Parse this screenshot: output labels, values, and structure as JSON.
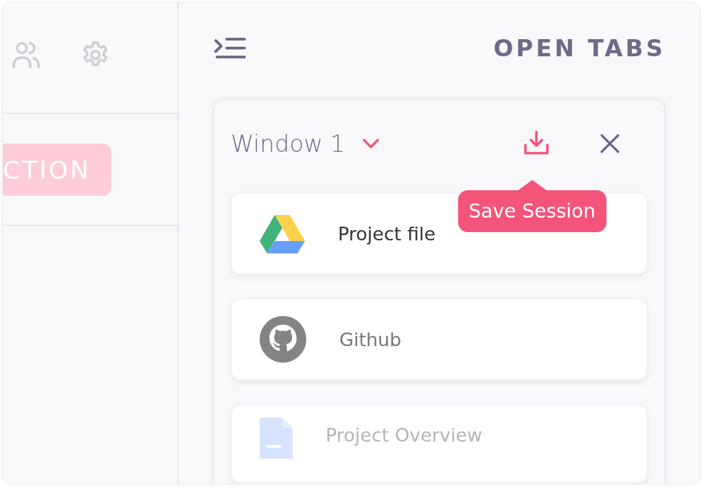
{
  "sidebar": {
    "icons": [
      {
        "kind": "users"
      },
      {
        "kind": "settings"
      }
    ],
    "action_button": "CTION"
  },
  "panel": {
    "title": "OPEN TABS",
    "window": {
      "title": "Window 1",
      "expanded": true,
      "tooltip": "Save Session",
      "tabs": [
        {
          "kind": "drive",
          "title": "Project file"
        },
        {
          "kind": "github",
          "title": "Github"
        },
        {
          "kind": "doc",
          "title": "Project Overview"
        }
      ]
    }
  }
}
